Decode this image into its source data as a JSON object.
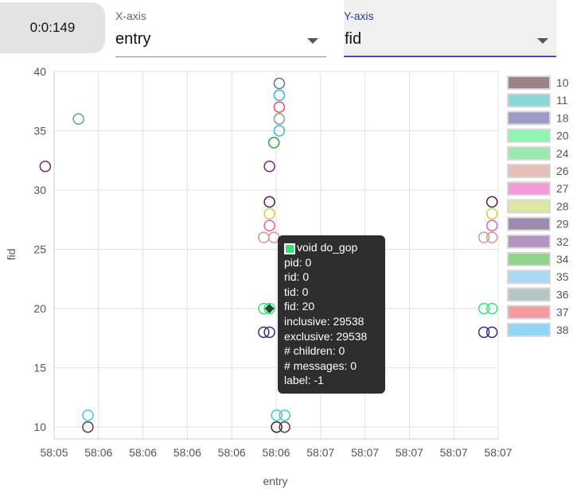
{
  "timer": {
    "label": "0:0:149"
  },
  "x_select": {
    "label": "X-axis",
    "value": "entry"
  },
  "y_select": {
    "label": "Y-axis",
    "value": "fid"
  },
  "tooltip": {
    "title": "void do_gop",
    "swatch_color": "#3ce07a",
    "lines": [
      "pid: 0",
      "rid: 0",
      "tid: 0",
      "fid: 20",
      "inclusive: 29538",
      "exclusive: 29538",
      "# children: 0",
      "# messages: 0",
      "label: -1"
    ]
  },
  "chart_data": {
    "type": "scatter",
    "xlabel": "entry",
    "ylabel": "fid",
    "x_tick_labels": [
      "58:05",
      "58:06",
      "58:06",
      "58:06",
      "58:06",
      "58:06",
      "58:07",
      "58:07",
      "58:07",
      "58:07",
      "58:07"
    ],
    "xlim": [
      0,
      10
    ],
    "ylim": [
      9,
      40
    ],
    "y_ticks": [
      10,
      15,
      20,
      25,
      30,
      35,
      40
    ],
    "grid": true,
    "legend_position": "right",
    "legend": [
      {
        "name": "10",
        "color": "#9e8387"
      },
      {
        "name": "11",
        "color": "#8ad7d5"
      },
      {
        "name": "18",
        "color": "#9d9bc7"
      },
      {
        "name": "20",
        "color": "#8ff5b2"
      },
      {
        "name": "24",
        "color": "#98e9af"
      },
      {
        "name": "26",
        "color": "#e5bfba"
      },
      {
        "name": "27",
        "color": "#f59ad8"
      },
      {
        "name": "28",
        "color": "#dde6a2"
      },
      {
        "name": "29",
        "color": "#9d8aac"
      },
      {
        "name": "32",
        "color": "#b495c2"
      },
      {
        "name": "34",
        "color": "#8fd48d"
      },
      {
        "name": "35",
        "color": "#a8d8f2"
      },
      {
        "name": "36",
        "color": "#b5c5c5"
      },
      {
        "name": "37",
        "color": "#f79aa2"
      },
      {
        "name": "38",
        "color": "#8fd6f7"
      }
    ],
    "points": [
      {
        "x": -0.2,
        "y": 32,
        "stroke": "#6a2c70"
      },
      {
        "x": 0.55,
        "y": 36,
        "stroke": "#5f9ea0"
      },
      {
        "x": 0.76,
        "y": 11,
        "stroke": "#3fc8d0"
      },
      {
        "x": 0.76,
        "y": 10,
        "stroke": "#5a3a3a"
      },
      {
        "x": 5.07,
        "y": 39,
        "stroke": "#6a6fa8"
      },
      {
        "x": 5.07,
        "y": 38,
        "stroke": "#2fb5d8"
      },
      {
        "x": 5.07,
        "y": 37,
        "stroke": "#e0555f"
      },
      {
        "x": 5.07,
        "y": 36,
        "stroke": "#8a9a9a"
      },
      {
        "x": 5.07,
        "y": 35,
        "stroke": "#3fb8d0"
      },
      {
        "x": 4.95,
        "y": 34,
        "stroke": "#2fa33a"
      },
      {
        "x": 4.85,
        "y": 32,
        "stroke": "#6a2c70"
      },
      {
        "x": 4.85,
        "y": 29,
        "stroke": "#4a1f4a"
      },
      {
        "x": 4.85,
        "y": 28,
        "stroke": "#c8d04a"
      },
      {
        "x": 4.85,
        "y": 27,
        "stroke": "#e05fbf"
      },
      {
        "x": 4.72,
        "y": 26,
        "stroke": "#c89a92"
      },
      {
        "x": 4.95,
        "y": 26,
        "stroke": "#c89a92"
      },
      {
        "x": 4.72,
        "y": 20,
        "stroke": "#3ce07a"
      },
      {
        "x": 4.85,
        "y": 20,
        "stroke": "#3ce07a"
      },
      {
        "x": 4.72,
        "y": 18,
        "stroke": "#3a2f7a"
      },
      {
        "x": 4.85,
        "y": 18,
        "stroke": "#3a2f7a"
      },
      {
        "x": 5.01,
        "y": 11,
        "stroke": "#3fc8d0"
      },
      {
        "x": 5.19,
        "y": 11,
        "stroke": "#3fc8d0"
      },
      {
        "x": 5.01,
        "y": 10,
        "stroke": "#3a1f1f"
      },
      {
        "x": 5.19,
        "y": 10,
        "stroke": "#5a3a3a"
      },
      {
        "x": 9.86,
        "y": 29,
        "stroke": "#4a1f4a"
      },
      {
        "x": 9.86,
        "y": 28,
        "stroke": "#c8d04a"
      },
      {
        "x": 9.86,
        "y": 27,
        "stroke": "#e05fbf"
      },
      {
        "x": 9.68,
        "y": 26,
        "stroke": "#c89a92"
      },
      {
        "x": 9.86,
        "y": 26,
        "stroke": "#c89a92"
      },
      {
        "x": 9.68,
        "y": 20,
        "stroke": "#3ce07a"
      },
      {
        "x": 9.86,
        "y": 20,
        "stroke": "#3ce07a"
      },
      {
        "x": 9.68,
        "y": 18,
        "stroke": "#3a2f7a"
      },
      {
        "x": 9.86,
        "y": 18,
        "stroke": "#3a2f7a"
      }
    ],
    "highlighted_point": {
      "x": 4.85,
      "y": 20,
      "fill": "#1a4d2e"
    }
  }
}
